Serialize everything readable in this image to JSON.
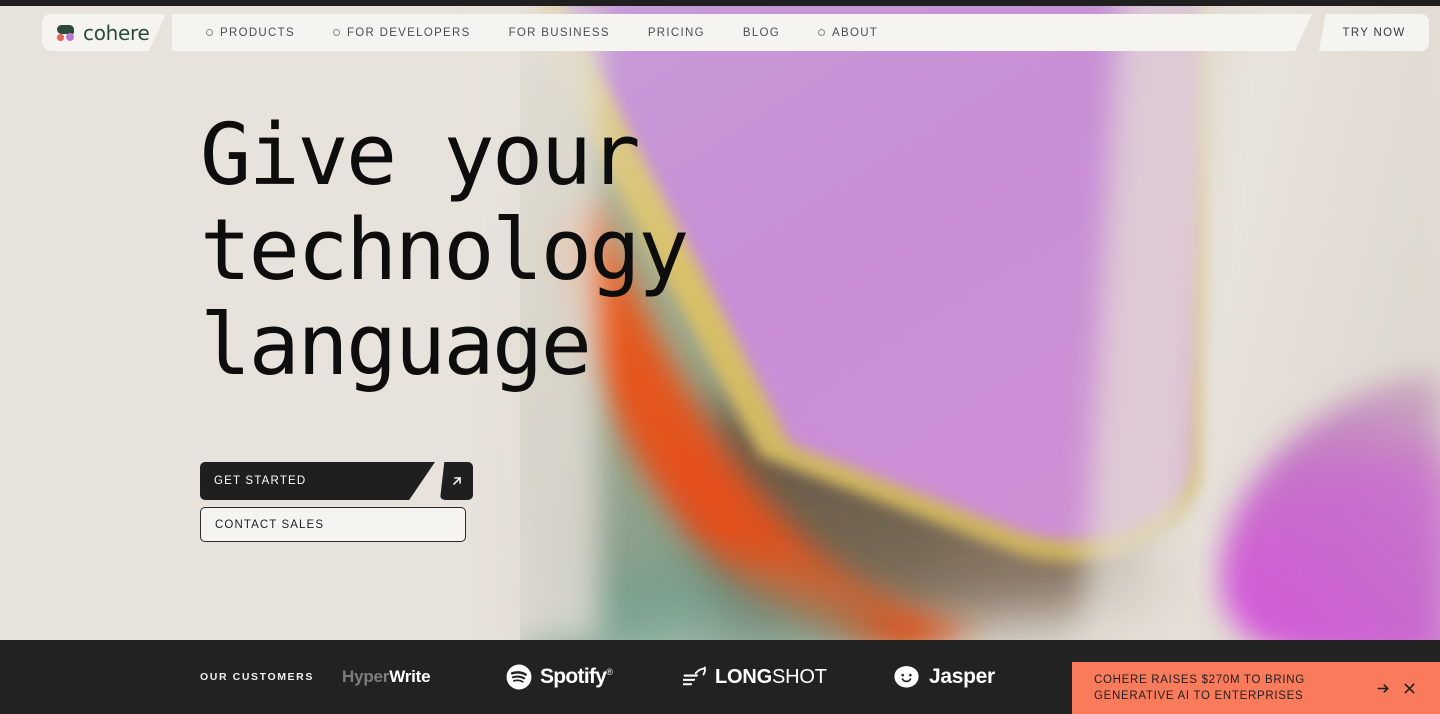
{
  "brand": {
    "name": "cohere",
    "logo_icon": "cohere-logo-mark",
    "logo_green": "#2a4a3c",
    "logo_coral": "#e8635a",
    "logo_purple": "#b77ad0"
  },
  "nav": {
    "items": [
      {
        "label": "PRODUCTS",
        "has_dropdown": true
      },
      {
        "label": "FOR DEVELOPERS",
        "has_dropdown": true
      },
      {
        "label": "FOR BUSINESS",
        "has_dropdown": false
      },
      {
        "label": "PRICING",
        "has_dropdown": false
      },
      {
        "label": "BLOG",
        "has_dropdown": false
      },
      {
        "label": "ABOUT",
        "has_dropdown": true
      }
    ],
    "cta": "TRY NOW"
  },
  "hero": {
    "headline_lines": [
      "Give your",
      "technology",
      "language"
    ],
    "primary_cta": "GET STARTED",
    "primary_cta_icon": "arrow-up-right-icon",
    "secondary_cta": "CONTACT SALES",
    "background_colors": {
      "page": "#e7e2db",
      "violet": "#c38ed0",
      "gold": "#d8c06a",
      "orange": "#e4561a",
      "sage": "#9aa78d",
      "magenta": "#cc5fd4"
    }
  },
  "customers": {
    "label": "OUR CUSTOMERS",
    "logos": [
      {
        "name": "HyperWrite",
        "part_dim": "Hyper",
        "part_bright": "Write"
      },
      {
        "name": "Spotify",
        "word": "Spotify",
        "trademark": "®",
        "icon": "spotify-icon"
      },
      {
        "name": "LongShot",
        "bold": "LONG",
        "light": "SHOT",
        "icon": "longshot-rocket-icon"
      },
      {
        "name": "Jasper",
        "word": "Jasper",
        "icon": "jasper-smiley-icon"
      }
    ]
  },
  "banner": {
    "text": "COHERE RAISES $270M TO BRING GENERATIVE AI TO ENTERPRISES",
    "background": "#fa7b5b",
    "go_icon": "arrow-right-icon",
    "close_icon": "close-icon"
  }
}
